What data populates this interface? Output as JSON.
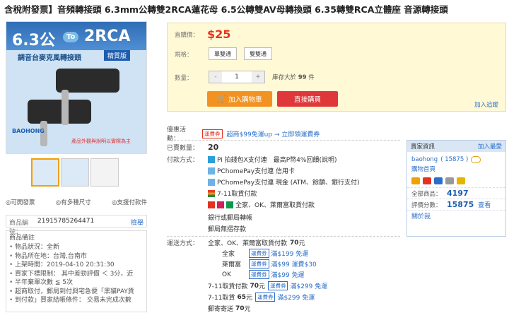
{
  "title": "含稅附發票】音頻轉接頭 6.3mm公轉雙2RCA蓮花母 6.5公轉雙AV母轉換頭 6.35轉雙RCA立體座 音源轉接頭",
  "image": {
    "text_63": "6.3公",
    "text_to": "To",
    "text_rca": "2RCA",
    "subtitle": "調音台麥克風轉接頭",
    "badge": "精質版",
    "logo": "BAOHONG",
    "note": "產品外觀與說明以實際為主"
  },
  "icons_row": {
    "invoice": "◎可開發票",
    "sizes": "◎有多種尺寸",
    "payment": "◎支援付款件"
  },
  "sku": {
    "label": "商品編號：",
    "value": "21915785264471",
    "action": "檢舉"
  },
  "notes": {
    "header": "商品備註",
    "items": [
      "物品狀況：全新",
      "物品所在地：台灣,台南市",
      "上架時間：2019-04-10 20:31:30",
      "買家下標限制： 其中差勁評價 ＜ 3分，近",
      "半年棄單次數 ≦ 5次",
      "超商取付，郵局到付與宅急便「黑貓PAY貨",
      "到付款」買家結帳條件： 交易未完成次數"
    ]
  },
  "buybox": {
    "price_label": "直購價：",
    "price": "$25",
    "spec_label": "規格：",
    "spec_options": [
      "單雙通",
      "雙雙通"
    ],
    "qty_label": "數量：",
    "qty_minus": "-",
    "qty_value": "1",
    "qty_plus": "+",
    "stock_text": "庫存大於",
    "stock_value": "99",
    "stock_unit": "件",
    "add_to_cart": "加入購物車",
    "buy_now": "直接購買",
    "track": "加入追蹤"
  },
  "promo": {
    "label": "優惠活動：",
    "tag": "運費券",
    "text": "超商$99免運up → 立即領運費券"
  },
  "details": {
    "sold_label": "已賣數量：",
    "sold_value": "20",
    "pay_label": "付款方式：",
    "payments": [
      "Pi 拍錢包X支付連　最高P幣4%回饋(說明)",
      "PChomePay支付連 信用卡",
      "PChomePay支付連 現金 (ATM、餘額、銀行支付)",
      "7-11取貨付款",
      "全家、OK、萊爾富取貨付款",
      "銀行或郵局轉帳",
      "郵局無摺存款"
    ],
    "ship_label": "運送方式：",
    "ship_head": "全家、OK、萊爾富取貨付款",
    "ship_head_price": "70",
    "ship_head_unit": "元",
    "ship_rows": [
      {
        "name": "全家",
        "tag": "運費券",
        "promo": "滿$199 免運"
      },
      {
        "name": "萊爾富",
        "tag": "運費券",
        "promo": "滿$99 運費$30"
      },
      {
        "name": "OK",
        "tag": "運費券",
        "promo": "滿$99 免運"
      }
    ],
    "ship_711": "7-11取貨付款",
    "ship_711_price": "70",
    "ship_711_unit": "元",
    "ship_711_tag": "運費券",
    "ship_711_promo": "滿$299 免運",
    "ship_7112": "7-11取貨",
    "ship_7112_price": "65",
    "ship_7112_unit": "元",
    "ship_7112_tag": "運費券",
    "ship_7112_promo": "滿$299 免運",
    "ship_post": "郵寄寄送",
    "ship_post_price": "70",
    "ship_post_unit": "元"
  },
  "seller": {
    "header": "賣家資訊",
    "follow": "加入最愛",
    "name": "baohong",
    "rating": "( 15875 )",
    "home": "購物首頁",
    "all_label": "全部商品：",
    "all_value": "4197",
    "rate_label": "評價分數：",
    "rate_value": "15875",
    "view": "查看",
    "about": "關於我"
  },
  "colors": {
    "price": "#e5321f",
    "cart": "#f29222",
    "buy": "#e0373a",
    "link": "#2a6ec7",
    "buybox_bg": "#fff9d6"
  }
}
